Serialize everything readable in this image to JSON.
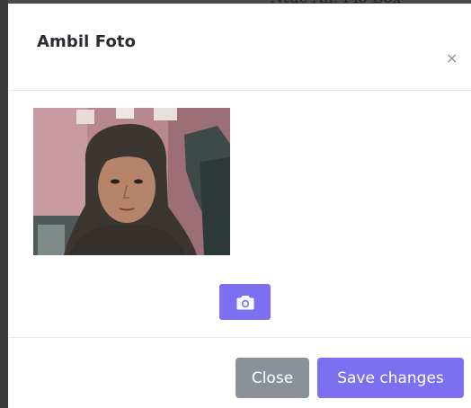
{
  "background": {
    "partial_text": "Ntuc Ali. Pio Box"
  },
  "modal": {
    "title": "Ambil Foto",
    "close_symbol": "×",
    "body": {
      "camera_preview_alt": "webcam preview",
      "snap_icon": "camera-icon"
    },
    "footer": {
      "close_label": "Close",
      "save_label": "Save changes"
    }
  },
  "colors": {
    "accent": "#7c6ff0",
    "secondary": "#8a9199"
  }
}
